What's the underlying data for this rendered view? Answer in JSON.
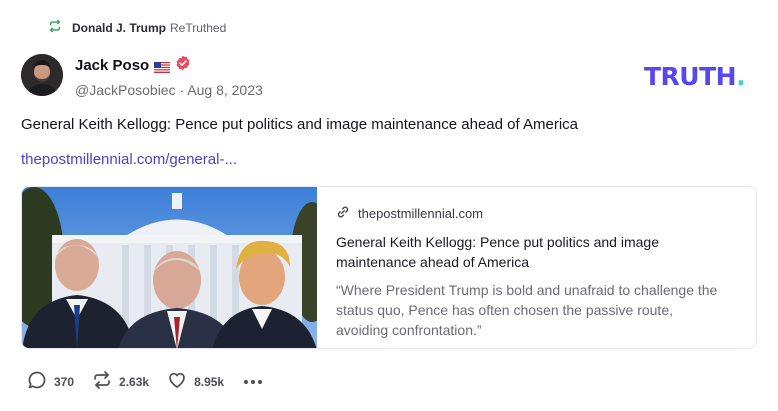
{
  "retruth": {
    "user": "Donald J. Trump",
    "label": "ReTruthed",
    "icon": "retruth-icon"
  },
  "author": {
    "name": "Jack Poso",
    "flag": "us-flag",
    "badge": "verified-badge",
    "handle": "@JackPosobiec",
    "separator": "·",
    "date": "Aug 8, 2023"
  },
  "brand": {
    "logo_text": "TRUTH",
    "logo_dot": ".",
    "colors": {
      "primary": "#5448ee",
      "accent": "#3ad6c8"
    }
  },
  "post": {
    "text": "General Keith Kellogg: Pence put politics and image maintenance ahead of America",
    "link_text": "thepostmillennial.com/general-..."
  },
  "link_card": {
    "domain": "thepostmillennial.com",
    "title": "General Keith Kellogg: Pence put politics and image maintenance ahead of America",
    "description": "“Where President Trump is bold and unafraid to challenge the status quo, Pence has often chosen the passive route, avoiding confrontation.”"
  },
  "actions": {
    "replies": "370",
    "retruths": "2.63k",
    "likes": "8.95k"
  }
}
